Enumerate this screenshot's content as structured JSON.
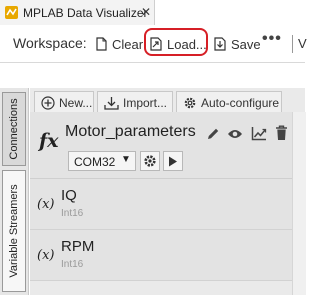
{
  "tab": {
    "title": "MPLAB Data Visualizer",
    "close": "✕"
  },
  "toolbar": {
    "workspace_label": "Workspace:",
    "clear_label": "Clear",
    "load_label": "Load...",
    "save_label": "Save",
    "more_label": "•••",
    "clipped_label": "V"
  },
  "side_tabs": {
    "connections": "Connections",
    "variable_streamers": "Variable Streamers"
  },
  "panel_toolbar": {
    "new_label": "New...",
    "import_label": "Import...",
    "autoconfig_label": "Auto-configure"
  },
  "function": {
    "symbol": "fx",
    "name": "Motor_parameters",
    "port": "COM32"
  },
  "variables": [
    {
      "symbol": "(x)",
      "name": "IQ",
      "type": "Int16"
    },
    {
      "symbol": "(x)",
      "name": "RPM",
      "type": "Int16"
    }
  ],
  "colors": {
    "highlight": "#d61f26",
    "accent": "#1a5fb4",
    "panel": "#eaeaea"
  }
}
